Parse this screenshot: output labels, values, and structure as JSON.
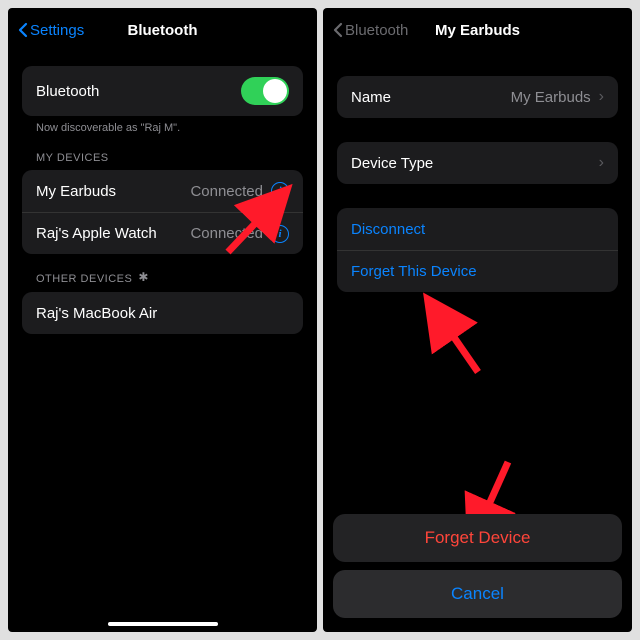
{
  "left": {
    "nav": {
      "back": "Settings",
      "title": "Bluetooth"
    },
    "toggle_row": {
      "label": "Bluetooth"
    },
    "discoverable_text": "Now discoverable as \"Raj M\".",
    "my_devices_header": "MY DEVICES",
    "my_devices": [
      {
        "name": "My Earbuds",
        "status": "Connected"
      },
      {
        "name": "Raj's Apple Watch",
        "status": "Connected"
      }
    ],
    "other_devices_header": "OTHER DEVICES",
    "other_devices": [
      {
        "name": "Raj's MacBook Air"
      }
    ]
  },
  "right": {
    "nav": {
      "back": "Bluetooth",
      "title": "My Earbuds"
    },
    "rows": {
      "name_label": "Name",
      "name_value": "My Earbuds",
      "device_type_label": "Device Type",
      "disconnect": "Disconnect",
      "forget": "Forget This Device"
    },
    "sheet": {
      "forget": "Forget Device",
      "cancel": "Cancel"
    }
  }
}
